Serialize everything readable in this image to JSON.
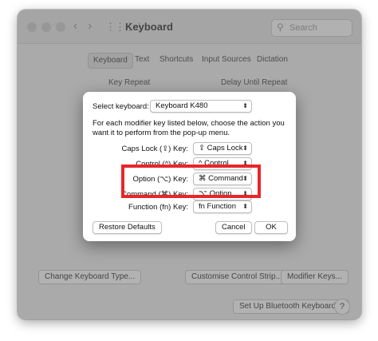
{
  "window": {
    "title": "Keyboard",
    "search_placeholder": "Search",
    "grid_icon": "grid-icon",
    "tabs": [
      "Keyboard",
      "Text",
      "Shortcuts",
      "Input Sources",
      "Dictation"
    ],
    "selected_tab": "Keyboard",
    "key_repeat_label": "Key Repeat",
    "delay_label": "Delay Until Repeat",
    "bottom_buttons": {
      "change_type": "Change Keyboard Type...",
      "customise_strip": "Customise Control Strip...",
      "modifier_keys": "Modifier Keys...",
      "bluetooth": "Set Up Bluetooth Keyboard...",
      "help": "?"
    }
  },
  "sheet": {
    "select_label": "Select keyboard:",
    "selected_keyboard": "Keyboard K480",
    "description": "For each modifier key listed below, choose the action you want it to perform from the pop-up menu.",
    "rows": [
      {
        "key": "Caps Lock (⇪) Key:",
        "action": "⇪ Caps Lock"
      },
      {
        "key": "Control (^) Key:",
        "action": "^ Control"
      },
      {
        "key": "Option (⌥) Key:",
        "action": "⌘ Command"
      },
      {
        "key": "Command (⌘) Key:",
        "action": "⌥ Option"
      },
      {
        "key": "Function (fn) Key:",
        "action": "fn Function"
      }
    ],
    "restore_label": "Restore Defaults",
    "cancel_label": "Cancel",
    "ok_label": "OK"
  },
  "colors": {
    "highlight": "#e8262a",
    "ok_accent": "#ffffff"
  }
}
